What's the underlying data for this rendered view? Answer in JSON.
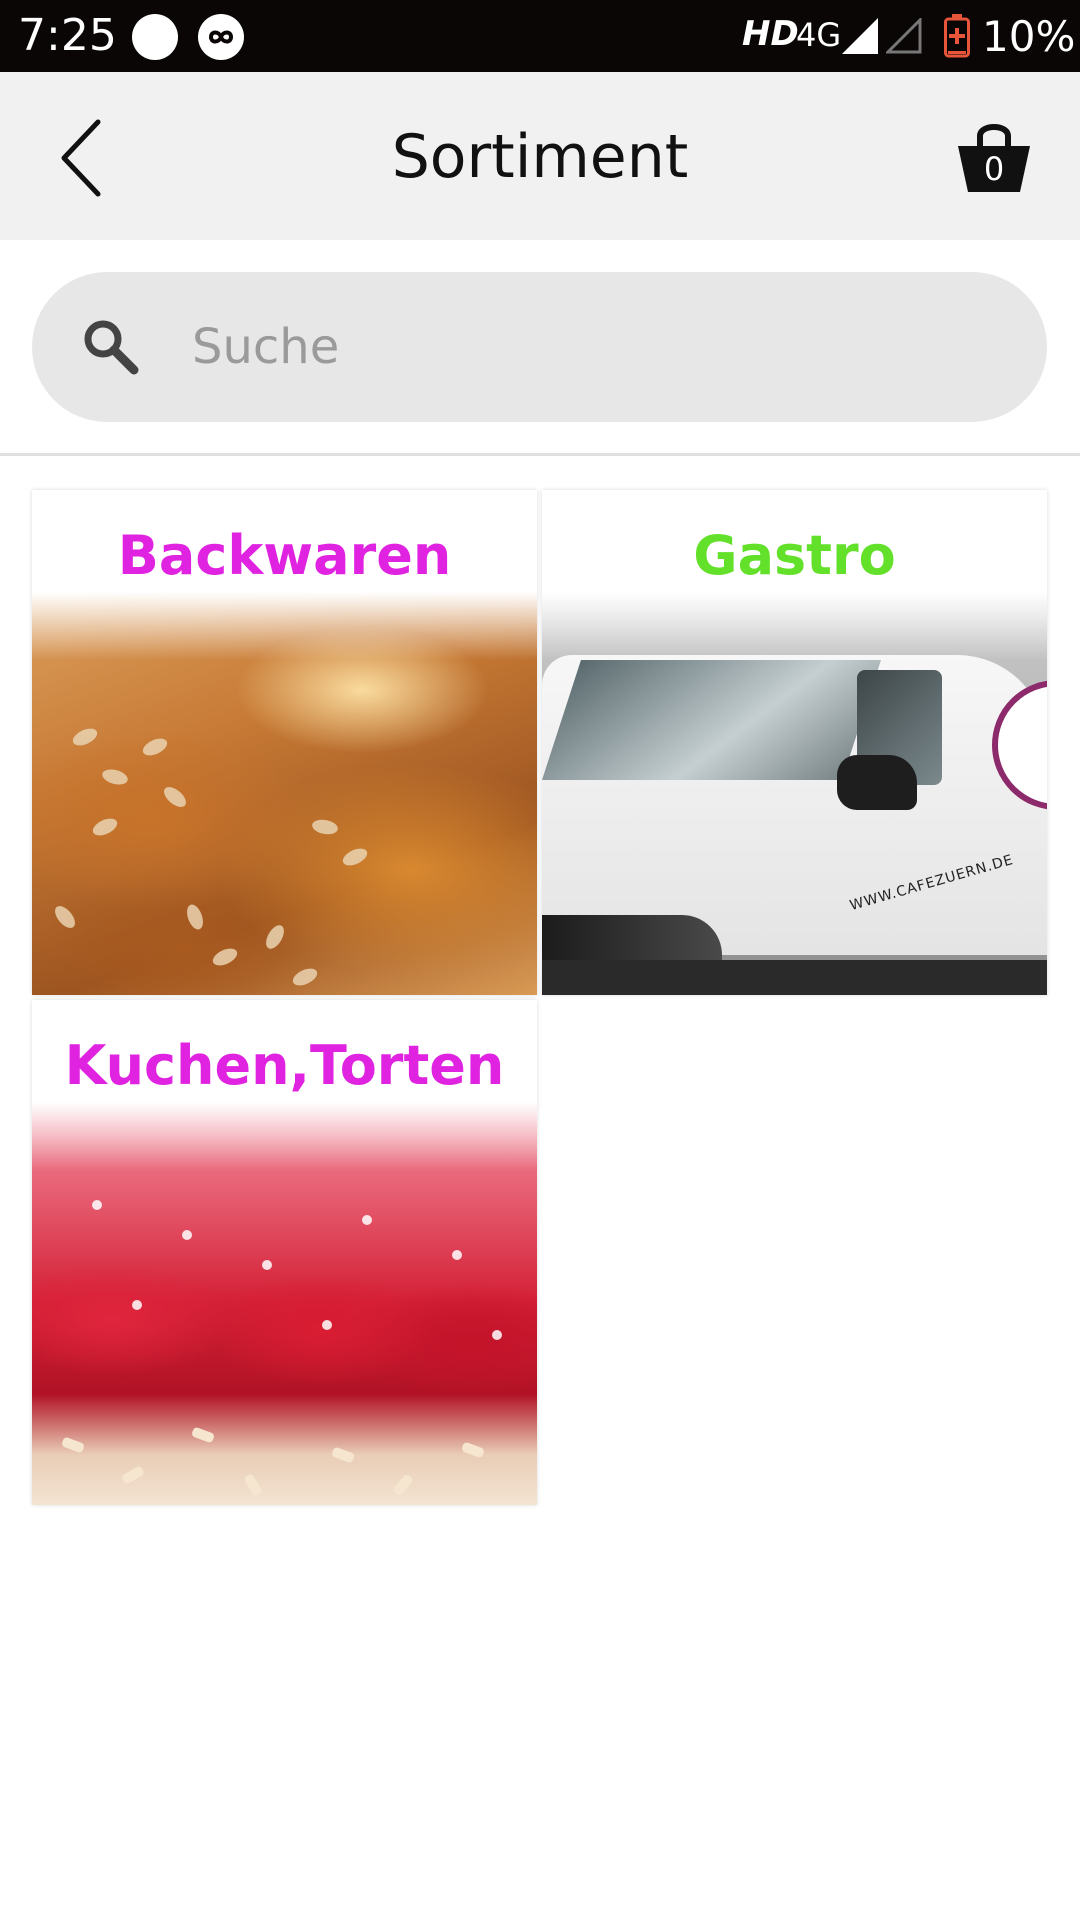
{
  "status_bar": {
    "time": "7:25",
    "hd": "HD",
    "network": "4G",
    "battery_percent": "10%",
    "battery_level": 0.1
  },
  "app_bar": {
    "title": "Sortiment",
    "cart_count": "0"
  },
  "search": {
    "placeholder": "Suche",
    "value": ""
  },
  "categories": [
    {
      "label": "Backwaren",
      "color": "#e023e0"
    },
    {
      "label": "Gastro",
      "color": "#62e02a"
    },
    {
      "label": "Kuchen,Torten",
      "color": "#e023e0"
    }
  ],
  "van_lettering": "WWW.CAFEZUERN.DE"
}
